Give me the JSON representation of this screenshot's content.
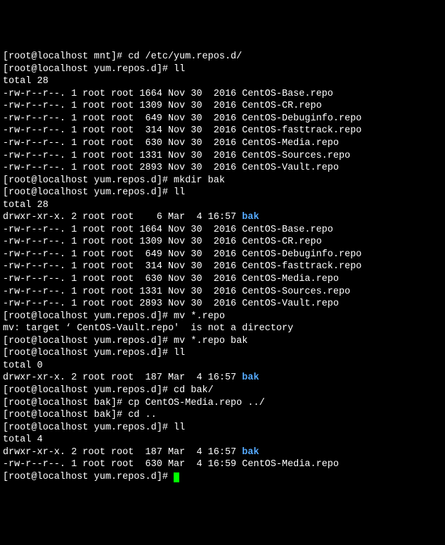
{
  "session": {
    "lines": [
      {
        "type": "cmd",
        "prompt": "[root@localhost mnt]# ",
        "text": "cd /etc/yum.repos.d/"
      },
      {
        "type": "cmd",
        "prompt": "[root@localhost yum.repos.d]# ",
        "text": "ll"
      },
      {
        "type": "out",
        "text": "total 28"
      },
      {
        "type": "ls",
        "perm": "-rw-r--r--.",
        "n": "1",
        "u": "root",
        "g": "root",
        "size": "1664",
        "date": "Nov 30  2016",
        "name": "CentOS-Base.repo",
        "color": ""
      },
      {
        "type": "ls",
        "perm": "-rw-r--r--.",
        "n": "1",
        "u": "root",
        "g": "root",
        "size": "1309",
        "date": "Nov 30  2016",
        "name": "CentOS-CR.repo",
        "color": ""
      },
      {
        "type": "ls",
        "perm": "-rw-r--r--.",
        "n": "1",
        "u": "root",
        "g": "root",
        "size": " 649",
        "date": "Nov 30  2016",
        "name": "CentOS-Debuginfo.repo",
        "color": ""
      },
      {
        "type": "ls",
        "perm": "-rw-r--r--.",
        "n": "1",
        "u": "root",
        "g": "root",
        "size": " 314",
        "date": "Nov 30  2016",
        "name": "CentOS-fasttrack.repo",
        "color": ""
      },
      {
        "type": "ls",
        "perm": "-rw-r--r--.",
        "n": "1",
        "u": "root",
        "g": "root",
        "size": " 630",
        "date": "Nov 30  2016",
        "name": "CentOS-Media.repo",
        "color": ""
      },
      {
        "type": "ls",
        "perm": "-rw-r--r--.",
        "n": "1",
        "u": "root",
        "g": "root",
        "size": "1331",
        "date": "Nov 30  2016",
        "name": "CentOS-Sources.repo",
        "color": ""
      },
      {
        "type": "ls",
        "perm": "-rw-r--r--.",
        "n": "1",
        "u": "root",
        "g": "root",
        "size": "2893",
        "date": "Nov 30  2016",
        "name": "CentOS-Vault.repo",
        "color": ""
      },
      {
        "type": "cmd",
        "prompt": "[root@localhost yum.repos.d]# ",
        "text": "mkdir bak"
      },
      {
        "type": "cmd",
        "prompt": "[root@localhost yum.repos.d]# ",
        "text": "ll"
      },
      {
        "type": "out",
        "text": "total 28"
      },
      {
        "type": "ls",
        "perm": "drwxr-xr-x.",
        "n": "2",
        "u": "root",
        "g": "root",
        "size": "   6",
        "date": "Mar  4 16:57",
        "name": "bak",
        "color": "blue"
      },
      {
        "type": "ls",
        "perm": "-rw-r--r--.",
        "n": "1",
        "u": "root",
        "g": "root",
        "size": "1664",
        "date": "Nov 30  2016",
        "name": "CentOS-Base.repo",
        "color": ""
      },
      {
        "type": "ls",
        "perm": "-rw-r--r--.",
        "n": "1",
        "u": "root",
        "g": "root",
        "size": "1309",
        "date": "Nov 30  2016",
        "name": "CentOS-CR.repo",
        "color": ""
      },
      {
        "type": "ls",
        "perm": "-rw-r--r--.",
        "n": "1",
        "u": "root",
        "g": "root",
        "size": " 649",
        "date": "Nov 30  2016",
        "name": "CentOS-Debuginfo.repo",
        "color": ""
      },
      {
        "type": "ls",
        "perm": "-rw-r--r--.",
        "n": "1",
        "u": "root",
        "g": "root",
        "size": " 314",
        "date": "Nov 30  2016",
        "name": "CentOS-fasttrack.repo",
        "color": ""
      },
      {
        "type": "ls",
        "perm": "-rw-r--r--.",
        "n": "1",
        "u": "root",
        "g": "root",
        "size": " 630",
        "date": "Nov 30  2016",
        "name": "CentOS-Media.repo",
        "color": ""
      },
      {
        "type": "ls",
        "perm": "-rw-r--r--.",
        "n": "1",
        "u": "root",
        "g": "root",
        "size": "1331",
        "date": "Nov 30  2016",
        "name": "CentOS-Sources.repo",
        "color": ""
      },
      {
        "type": "ls",
        "perm": "-rw-r--r--.",
        "n": "1",
        "u": "root",
        "g": "root",
        "size": "2893",
        "date": "Nov 30  2016",
        "name": "CentOS-Vault.repo",
        "color": ""
      },
      {
        "type": "cmd",
        "prompt": "[root@localhost yum.repos.d]# ",
        "text": "mv *.repo"
      },
      {
        "type": "out",
        "text": "mv: target ‘ CentOS-Vault.repo'  is not a directory"
      },
      {
        "type": "cmd",
        "prompt": "[root@localhost yum.repos.d]# ",
        "text": "mv *.repo bak"
      },
      {
        "type": "cmd",
        "prompt": "[root@localhost yum.repos.d]# ",
        "text": "ll"
      },
      {
        "type": "out",
        "text": "total 0"
      },
      {
        "type": "ls",
        "perm": "drwxr-xr-x.",
        "n": "2",
        "u": "root",
        "g": "root",
        "size": "187",
        "date": "Mar  4 16:57",
        "name": "bak",
        "color": "blue"
      },
      {
        "type": "cmd",
        "prompt": "[root@localhost yum.repos.d]# ",
        "text": "cd bak/"
      },
      {
        "type": "cmd",
        "prompt": "[root@localhost bak]# ",
        "text": "cp CentOS-Media.repo ../"
      },
      {
        "type": "cmd",
        "prompt": "[root@localhost bak]# ",
        "text": "cd .."
      },
      {
        "type": "cmd",
        "prompt": "[root@localhost yum.repos.d]# ",
        "text": "ll"
      },
      {
        "type": "out",
        "text": "total 4"
      },
      {
        "type": "ls",
        "perm": "drwxr-xr-x.",
        "n": "2",
        "u": "root",
        "g": "root",
        "size": "187",
        "date": "Mar  4 16:57",
        "name": "bak",
        "color": "blue"
      },
      {
        "type": "ls",
        "perm": "-rw-r--r--.",
        "n": "1",
        "u": "root",
        "g": "root",
        "size": "630",
        "date": "Mar  4 16:59",
        "name": "CentOS-Media.repo",
        "color": ""
      },
      {
        "type": "cursor",
        "prompt": "[root@localhost yum.repos.d]# "
      }
    ]
  }
}
